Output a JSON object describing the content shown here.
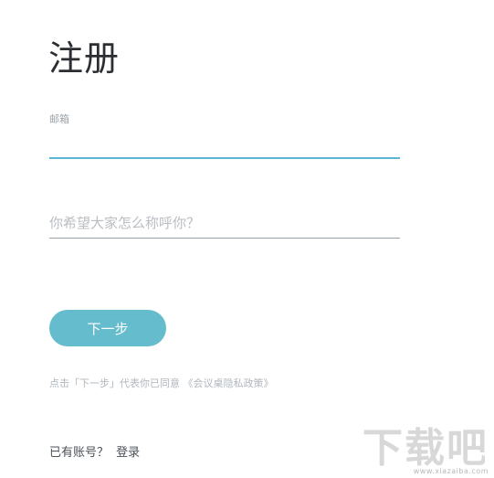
{
  "page": {
    "title": "注册"
  },
  "form": {
    "email_label": "邮箱",
    "email_value": "",
    "name_placeholder": "你希望大家怎么称呼你？",
    "next_button_label": "下一步"
  },
  "agreement": {
    "prefix": "点击「下一步」代表你已同意",
    "policy_link": "《会议桌隐私政策》"
  },
  "login": {
    "prompt": "已有账号？",
    "link_label": "登录"
  },
  "watermark": {
    "logo_text": "下载吧",
    "url": "www.xiazaiba.com"
  },
  "colors": {
    "accent": "#65bccd",
    "focus_underline": "#5bb5d4",
    "title": "#2b2f33",
    "muted": "#b0b7bd"
  }
}
